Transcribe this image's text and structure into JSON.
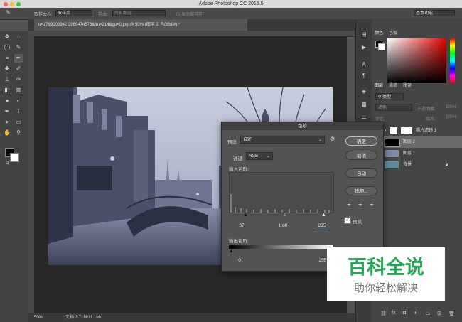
{
  "window": {
    "title": "Adobe Photoshop CC 2015.5"
  },
  "options_bar": {
    "sample_size_label": "取样大小:",
    "sample_size_value": "取样点",
    "sample_label": "样本:",
    "sample_value": "所有图层",
    "show_ring_label": "显示取样环",
    "workspace": "基本功能"
  },
  "document": {
    "tab_title": "u=1799003942,3969474578&fm=214&gp=0.jpg @ 50% (图层 2, RGB/8#) *",
    "zoom": "50%",
    "file_info": "文档:3.71M/11.1M"
  },
  "color_panel": {
    "tabs": [
      "颜色",
      "色板"
    ],
    "fg_color": "#000000",
    "bg_color": "#ffffff"
  },
  "layers_panel": {
    "tabs": [
      "图层",
      "通道",
      "路径"
    ],
    "kind_label": "类型",
    "blend_mode": "滤色",
    "opacity_label": "不透明度:",
    "opacity_value": "100%",
    "lock_label": "锁定:",
    "fill_label": "填充:",
    "fill_value": "100%",
    "layers": [
      {
        "name": "照片滤镜 1",
        "type": "adjustment",
        "selected": false
      },
      {
        "name": "图层 2",
        "type": "black",
        "selected": true
      },
      {
        "name": "图层 1",
        "type": "photo",
        "selected": false
      },
      {
        "name": "背景",
        "type": "photo",
        "selected": false
      }
    ]
  },
  "levels_dialog": {
    "title": "色阶",
    "preset_label": "预设:",
    "preset_value": "自定",
    "channel_label": "通道:",
    "channel_value": "RGB",
    "input_label": "输入色阶:",
    "input_black": "37",
    "input_gamma": "1.00",
    "input_white": "235",
    "output_label": "输出色阶:",
    "output_black": "0",
    "output_white": "255",
    "buttons": {
      "ok": "确定",
      "cancel": "取消",
      "auto": "自动",
      "options": "选项..."
    },
    "preview_label": "预览",
    "preview_checked": true
  },
  "watermark": {
    "title": "百科全说",
    "subtitle": "助你轻松解决",
    "color": "#22aa55"
  }
}
